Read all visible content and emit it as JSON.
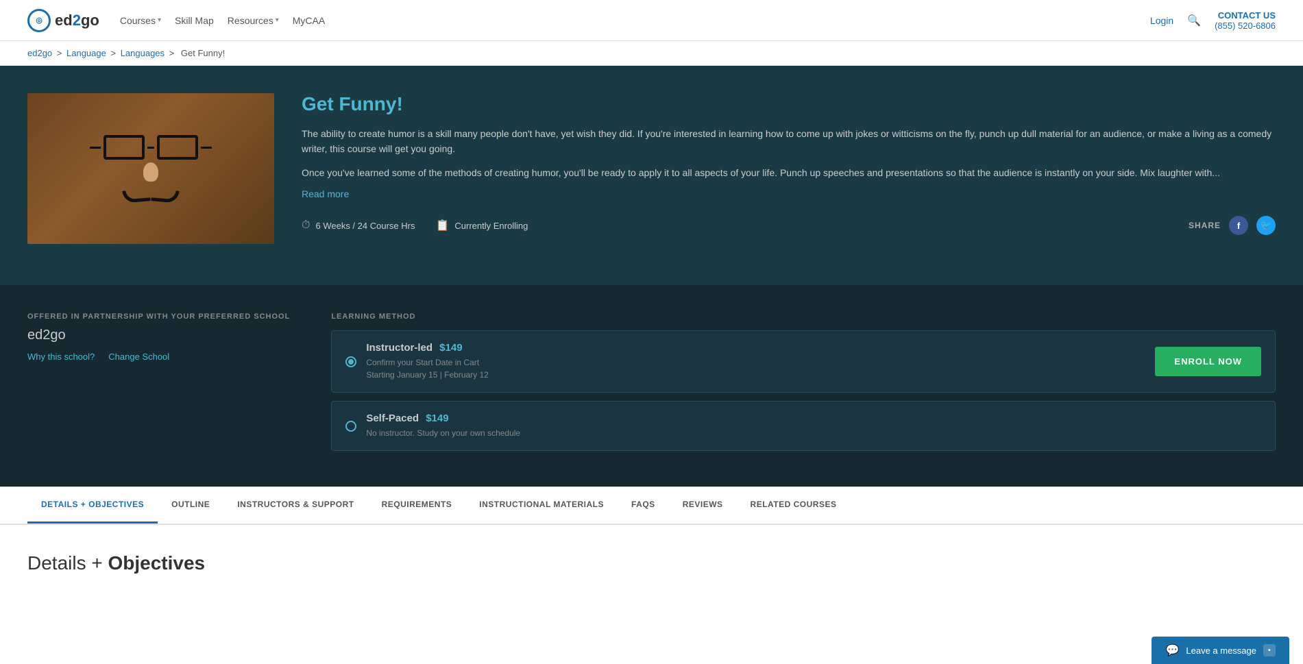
{
  "header": {
    "logo_text": "ed2go",
    "logo_icon": "◎",
    "nav_items": [
      {
        "label": "Courses",
        "has_dropdown": true
      },
      {
        "label": "Skill Map",
        "has_dropdown": false
      },
      {
        "label": "Resources",
        "has_dropdown": true
      },
      {
        "label": "MyCAA",
        "has_dropdown": false
      }
    ],
    "login_label": "Login",
    "contact_us_label": "CONTACT US",
    "contact_phone": "(855) 520-6806"
  },
  "breadcrumb": {
    "items": [
      {
        "label": "ed2go",
        "href": "#"
      },
      {
        "label": "Language",
        "href": "#"
      },
      {
        "label": "Languages",
        "href": "#"
      },
      {
        "label": "Get Funny!",
        "href": null
      }
    ]
  },
  "hero": {
    "title": "Get Funny!",
    "description_1": "The ability to create humor is a skill many people don't have, yet wish they did. If you're interested in learning how to come up with jokes or witticisms on the fly, punch up dull material for an audience, or make a living as a comedy writer, this course will get you going.",
    "description_2": "Once you've learned some of the methods of creating humor, you'll be ready to apply it to all aspects of your life. Punch up speeches and presentations so that the audience is instantly on your side. Mix laughter with...",
    "read_more": "Read more",
    "duration": "6 Weeks / 24 Course Hrs",
    "enrollment_status": "Currently Enrolling",
    "share_label": "SHARE"
  },
  "enrollment": {
    "partnership_label": "OFFERED IN PARTNERSHIP WITH YOUR PREFERRED SCHOOL",
    "school_name": "ed2go",
    "why_school_label": "Why this school?",
    "change_school_label": "Change School",
    "learning_method_label": "LEARNING METHOD",
    "options": [
      {
        "id": "instructor",
        "title": "Instructor-led",
        "price": "$149",
        "sub_line1": "Confirm your Start Date in Cart",
        "sub_line2": "Starting January 15 | February 12",
        "selected": true
      },
      {
        "id": "self-paced",
        "title": "Self-Paced",
        "price": "$149",
        "sub_line1": "No instructor. Study on your own schedule",
        "sub_line2": "",
        "selected": false
      }
    ],
    "enroll_button_label": "ENROLL NOW"
  },
  "tabs": [
    {
      "label": "DETAILS + OBJECTIVES",
      "active": true
    },
    {
      "label": "OUTLINE",
      "active": false
    },
    {
      "label": "INSTRUCTORS & SUPPORT",
      "active": false
    },
    {
      "label": "REQUIREMENTS",
      "active": false
    },
    {
      "label": "INSTRUCTIONAL MATERIALS",
      "active": false
    },
    {
      "label": "FAQS",
      "active": false
    },
    {
      "label": "REVIEWS",
      "active": false
    },
    {
      "label": "RELATED COURSES",
      "active": false
    }
  ],
  "details": {
    "title_part1": "Details +",
    "title_part2": "Objectives"
  },
  "live_chat": {
    "label": "Leave a message"
  }
}
